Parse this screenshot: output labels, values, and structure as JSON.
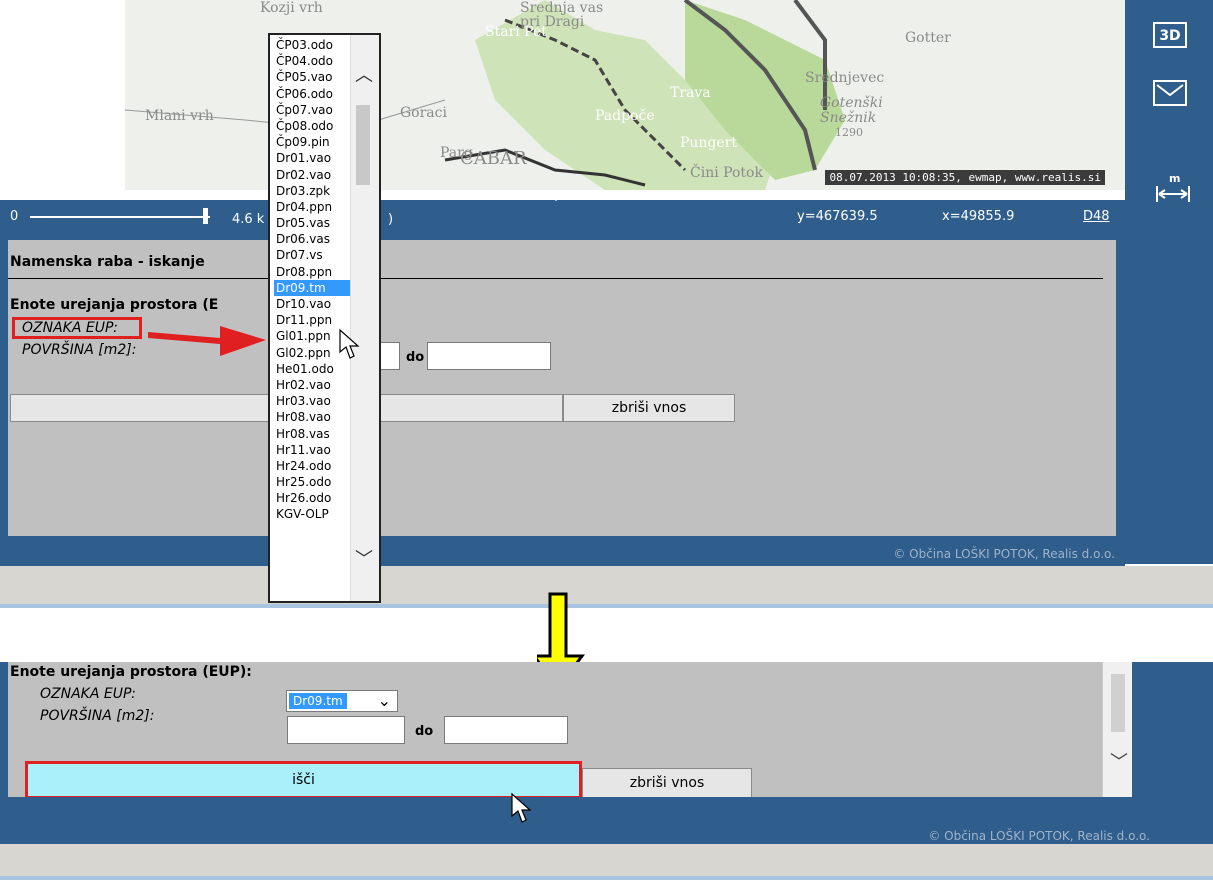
{
  "top": {
    "map": {
      "labels": [
        "Kozji vrh",
        "Srednja vas",
        "pri Dragi",
        "Gotter",
        "Stari Pet",
        "Mlani vrh",
        "Goraci",
        "Trava",
        "Padpoče",
        "Pungert",
        "Gotenški",
        "Snežnik",
        "1290",
        "Parg",
        "CABAR",
        "Čini Potok",
        "Srednjevec"
      ],
      "stamp": "08.07.2013 10:08:35, ewmap, www.realis.si"
    },
    "status": {
      "scale_start": "0",
      "scale_text": "4.6 k",
      "paren": ")",
      "y": "y=467639.5",
      "x": "x=49855.9",
      "link": "D48"
    },
    "side_icons": {
      "three_d": "3D",
      "measure_label": "m"
    },
    "panel": {
      "title": "Namenska raba - iskanje",
      "section": "Enote urejanja prostora (E",
      "oznaka_label": "OZNAKA EUP:",
      "povrsina_label": "POVRŠINA [m2]:",
      "do_label": "do",
      "clear_button": "zbriši vnos"
    },
    "footer": "© Občina LOŠKI POTOK, Realis d.o.o.",
    "dropdown": {
      "items": [
        "ČP03.odo",
        "ČP04.odo",
        "ČP05.vao",
        "ČP06.odo",
        "Čp07.vao",
        "Čp08.odo",
        "Čp09.pin",
        "Dr01.vao",
        "Dr02.vao",
        "Dr03.zpk",
        "Dr04.ppn",
        "Dr05.vas",
        "Dr06.vas",
        "Dr07.vs",
        "Dr08.ppn",
        "Dr09.tm",
        "Dr10.vao",
        "Dr11.ppn",
        "Gl01.ppn",
        "Gl02.ppn",
        "He01.odo",
        "Hr02.vao",
        "Hr03.vao",
        "Hr08.vao",
        "Hr08.vas",
        "Hr11.vao",
        "Hr24.odo",
        "Hr25.odo",
        "Hr26.odo",
        "KGV-OLP"
      ],
      "selected_index": 15
    }
  },
  "bottom": {
    "section": "Enote urejanja prostora (EUP):",
    "oznaka_label": "OZNAKA EUP:",
    "povrsina_label": "POVRŠINA [m2]:",
    "select_value": "Dr09.tm",
    "do_label": "do",
    "search_button": "išči",
    "clear_button": "zbriši vnos",
    "footer": "© Občina LOŠKI POTOK, Realis d.o.o."
  },
  "colors": {
    "frame": "#2f5d8c",
    "panel": "#c0c0c0",
    "highlight": "#e02020",
    "arrow": "#ffff00",
    "search_fill": "#a9f0fb"
  }
}
